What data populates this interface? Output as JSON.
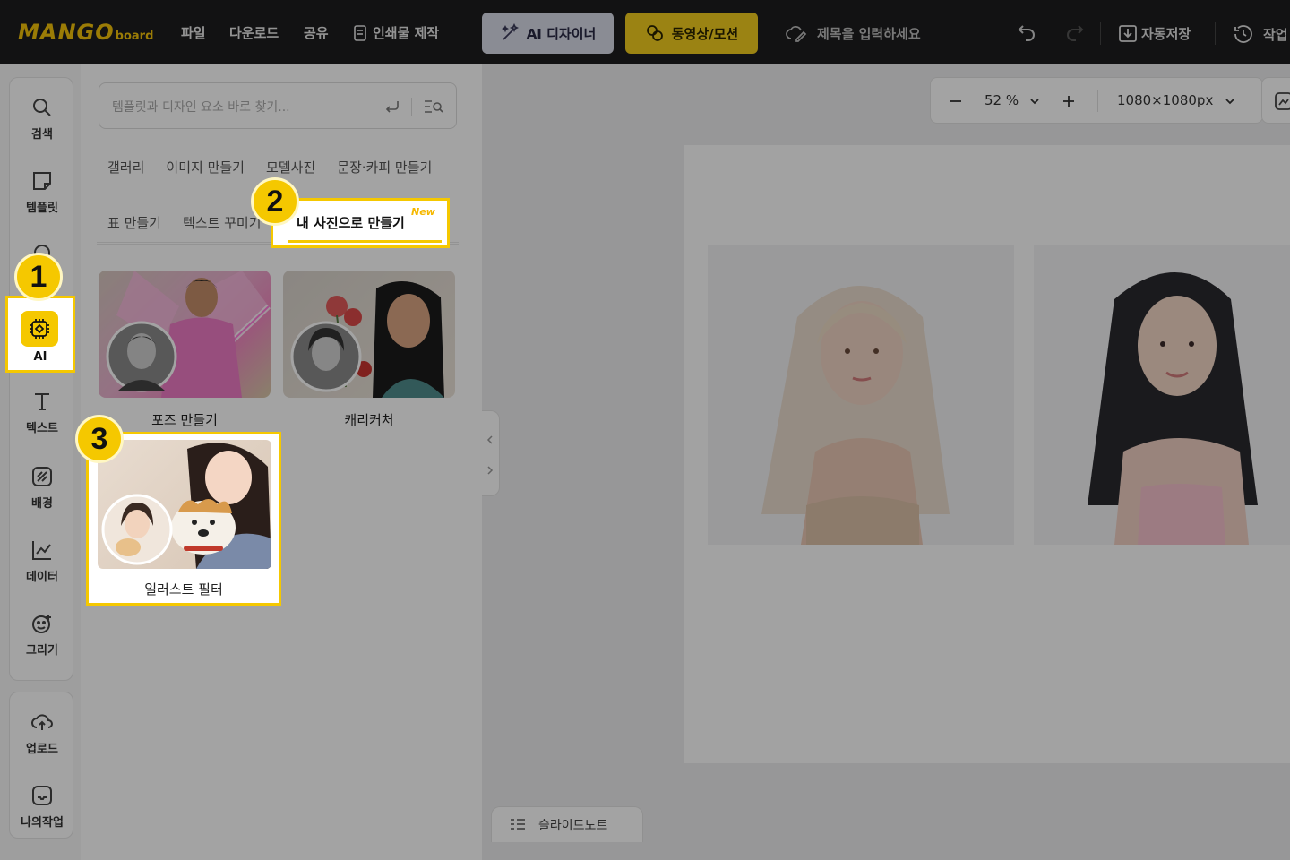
{
  "topbar": {
    "logo_main": "MANGO",
    "logo_sub": "board",
    "menu": [
      "파일",
      "다운로드",
      "공유",
      "인쇄물 제작"
    ],
    "ai_designer": "AI 디자이너",
    "video_motion": "동영상/모션",
    "title_placeholder": "제목을 입력하세요",
    "autosave": "자동저장",
    "history": "작업"
  },
  "rail": {
    "items": [
      {
        "label": "검색",
        "icon": "search-icon"
      },
      {
        "label": "템플릿",
        "icon": "template-icon"
      },
      {
        "label": "AI",
        "icon": "ai-chip-icon"
      },
      {
        "label": "텍스트",
        "icon": "text-icon"
      },
      {
        "label": "배경",
        "icon": "background-icon"
      },
      {
        "label": "데이터",
        "icon": "chart-icon"
      },
      {
        "label": "그리기",
        "icon": "draw-icon"
      }
    ],
    "bottom": [
      {
        "label": "업로드",
        "icon": "upload-icon"
      },
      {
        "label": "나의작업",
        "icon": "my-work-icon"
      }
    ]
  },
  "panel": {
    "search_placeholder": "템플릿과 디자인 요소 바로 찾기...",
    "tabs_row1": [
      "갤러리",
      "이미지 만들기",
      "모델사진",
      "문장·카피 만들기"
    ],
    "tabs_row2": [
      "표 만들기",
      "텍스트 꾸미기"
    ],
    "active_tab": "내 사진으로 만들기",
    "active_tab_badge": "New",
    "cards": [
      {
        "caption": "포즈 만들기"
      },
      {
        "caption": "캐리커처"
      },
      {
        "caption": "일러스트 필터"
      }
    ]
  },
  "canvas": {
    "zoom": "52 %",
    "size": "1080×1080px",
    "slide_note": "슬라이드노트"
  },
  "badges": [
    "1",
    "2",
    "3"
  ],
  "colors": {
    "accent": "#f5c800",
    "topbar": "#1d1d1f"
  }
}
